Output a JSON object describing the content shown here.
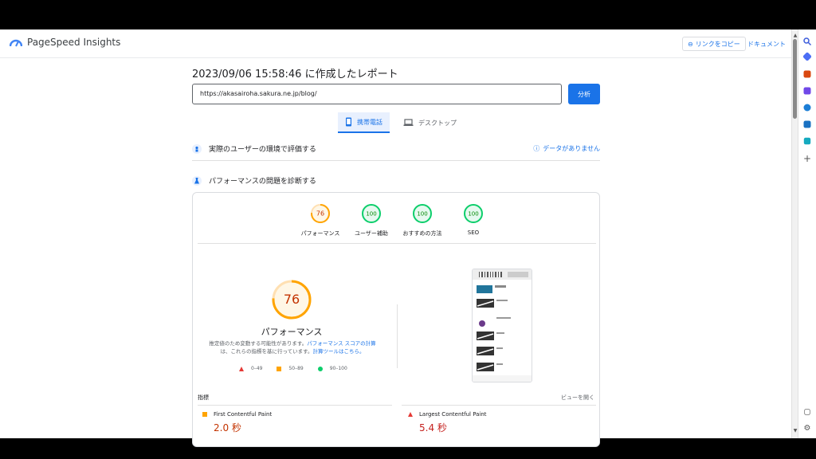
{
  "header": {
    "app_name": "PageSpeed Insights",
    "copy_link_label": "リンクをコピー",
    "docs_label": "ドキュメント"
  },
  "report": {
    "title": "2023/09/06 15:58:46 に作成したレポート",
    "url_value": "https://akasairoha.sakura.ne.jp/blog/",
    "analyze_label": "分析"
  },
  "tabs": [
    {
      "label": "携帯電話",
      "active": true,
      "icon": "phone-icon"
    },
    {
      "label": "デスクトップ",
      "active": false,
      "icon": "laptop-icon"
    }
  ],
  "field_section": {
    "title": "実際のユーザーの環境で評価する",
    "no_data_label": "データがありません"
  },
  "lab_section": {
    "title": "パフォーマンスの問題を診断する"
  },
  "scores": [
    {
      "label": "パフォーマンス",
      "value": "76",
      "color": "#ffa400"
    },
    {
      "label": "ユーザー補助",
      "value": "100",
      "color": "#0cce6b"
    },
    {
      "label": "おすすめの方法",
      "value": "100",
      "color": "#0cce6b"
    },
    {
      "label": "SEO",
      "value": "100",
      "color": "#0cce6b"
    }
  ],
  "performance": {
    "score": "76",
    "title": "パフォーマンス",
    "desc_1": "推定値のため変動する可能性があります。",
    "desc_link_1": "パフォーマンス スコアの計算",
    "desc_2": "は、これらの指標を基に行っています。",
    "desc_link_2": "計算ツールはこちら。",
    "legend": [
      {
        "range": "0–49",
        "shape": "triangle",
        "color": "#e53935"
      },
      {
        "range": "50–89",
        "shape": "square",
        "color": "#ffa400"
      },
      {
        "range": "90–100",
        "shape": "circle",
        "color": "#0cce6b"
      }
    ]
  },
  "metrics": {
    "header": "指標",
    "expand_label": "ビューを開く",
    "items": [
      {
        "name": "First Contentful Paint",
        "value": "2.0 秒",
        "color": "#ffa400",
        "shape": "square"
      },
      {
        "name": "Largest Contentful Paint",
        "value": "5.4 秒",
        "color": "#e53935",
        "shape": "triangle"
      }
    ]
  }
}
